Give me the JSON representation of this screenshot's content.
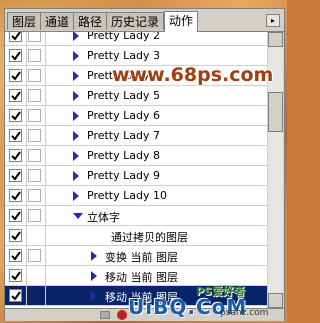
{
  "tabs": [
    {
      "label": "图层",
      "active": false
    },
    {
      "label": "通道",
      "active": false
    },
    {
      "label": "路径",
      "active": false
    },
    {
      "label": "历史记录",
      "active": false
    },
    {
      "label": "动作",
      "active": true
    }
  ],
  "menu_button_icon": "panel-menu-arrow-icon",
  "rows": [
    {
      "label": "Pretty Lady 2",
      "checked": true,
      "dialog": true,
      "indent": 1,
      "expand": "right",
      "selected": false
    },
    {
      "label": "Pretty Lady 3",
      "checked": true,
      "dialog": true,
      "indent": 1,
      "expand": "right",
      "selected": false
    },
    {
      "label": "Pretty Lady 4",
      "checked": true,
      "dialog": true,
      "indent": 1,
      "expand": "right",
      "selected": false
    },
    {
      "label": "Pretty Lady 5",
      "checked": true,
      "dialog": true,
      "indent": 1,
      "expand": "right",
      "selected": false
    },
    {
      "label": "Pretty Lady 6",
      "checked": true,
      "dialog": true,
      "indent": 1,
      "expand": "right",
      "selected": false
    },
    {
      "label": "Pretty Lady 7",
      "checked": true,
      "dialog": true,
      "indent": 1,
      "expand": "right",
      "selected": false
    },
    {
      "label": "Pretty Lady 8",
      "checked": true,
      "dialog": true,
      "indent": 1,
      "expand": "right",
      "selected": false
    },
    {
      "label": "Pretty Lady 9",
      "checked": true,
      "dialog": true,
      "indent": 1,
      "expand": "right",
      "selected": false
    },
    {
      "label": "Pretty Lady 10",
      "checked": true,
      "dialog": true,
      "indent": 1,
      "expand": "right",
      "selected": false
    },
    {
      "label": "立体字",
      "checked": true,
      "dialog": true,
      "indent": 1,
      "expand": "down",
      "selected": false
    },
    {
      "label": "通过拷贝的图层",
      "checked": true,
      "dialog": false,
      "indent": 3,
      "expand": "none",
      "selected": false
    },
    {
      "label": "变换 当前 图层",
      "checked": true,
      "dialog": true,
      "indent": 2,
      "expand": "right",
      "selected": false
    },
    {
      "label": "移动 当前 图层",
      "checked": true,
      "dialog": false,
      "indent": 2,
      "expand": "right",
      "selected": false
    },
    {
      "label": "移动 当前 图层",
      "checked": true,
      "dialog": false,
      "indent": 2,
      "expand": "right",
      "selected": true
    }
  ],
  "watermark_top": "www.68ps.com",
  "watermark_bottom": "UiBQ.CoM",
  "watermark_brand": "PS爱好者",
  "watermark_small": "psahz.com",
  "colors": {
    "selected_row": "#0a246a",
    "expand_arrow": "#2a2aa8",
    "record_button": "#c02020"
  }
}
